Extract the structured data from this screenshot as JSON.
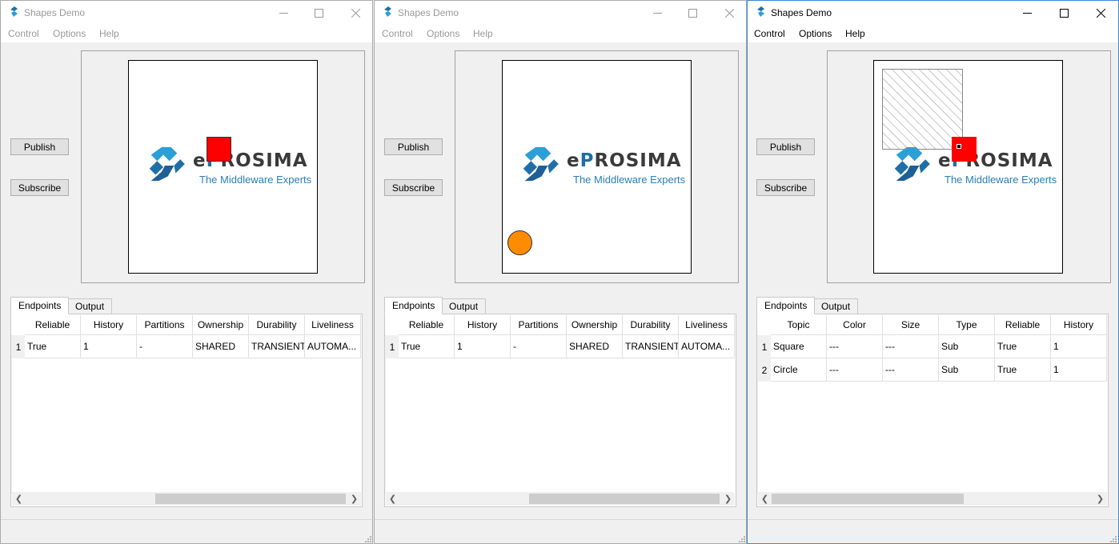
{
  "windows": [
    {
      "title": "Shapes Demo",
      "menu": [
        "Control",
        "Options",
        "Help"
      ],
      "buttons": {
        "publish": "Publish",
        "subscribe": "Subscribe"
      },
      "logo": {
        "word_prefix": "e",
        "word_accent": "P",
        "word_rest": "ROSIMA",
        "tagline": "The Middleware Experts"
      },
      "tabs": [
        "Endpoints",
        "Output"
      ],
      "table": {
        "headers": [
          "Reliable",
          "History",
          "Partitions",
          "Ownership",
          "Durability",
          "Liveliness"
        ],
        "rows": [
          {
            "num": "1",
            "cells": [
              "True",
              "1",
              "-",
              "SHARED",
              "TRANSIENT",
              "AUTOMA..."
            ]
          }
        ]
      },
      "shapes": [
        {
          "kind": "square",
          "color": "#ff0000"
        }
      ]
    },
    {
      "title": "Shapes Demo",
      "menu": [
        "Control",
        "Options",
        "Help"
      ],
      "buttons": {
        "publish": "Publish",
        "subscribe": "Subscribe"
      },
      "logo": {
        "word_prefix": "e",
        "word_accent": "P",
        "word_rest": "ROSIMA",
        "tagline": "The Middleware Experts"
      },
      "tabs": [
        "Endpoints",
        "Output"
      ],
      "table": {
        "headers": [
          "Reliable",
          "History",
          "Partitions",
          "Ownership",
          "Durability",
          "Liveliness"
        ],
        "rows": [
          {
            "num": "1",
            "cells": [
              "True",
              "1",
              "-",
              "SHARED",
              "TRANSIENT",
              "AUTOMA..."
            ]
          }
        ]
      },
      "shapes": [
        {
          "kind": "circle",
          "color": "#ff8c00"
        }
      ]
    },
    {
      "title": "Shapes Demo",
      "menu": [
        "Control",
        "Options",
        "Help"
      ],
      "buttons": {
        "publish": "Publish",
        "subscribe": "Subscribe"
      },
      "logo": {
        "word_prefix": "e",
        "word_accent": "P",
        "word_rest": "ROSIMA",
        "tagline": "The Middleware Experts"
      },
      "tabs": [
        "Endpoints",
        "Output"
      ],
      "table": {
        "headers": [
          "Topic",
          "Color",
          "Size",
          "Type",
          "Reliable",
          "History"
        ],
        "rows": [
          {
            "num": "1",
            "cells": [
              "Square",
              "---",
              "---",
              "Sub",
              "True",
              "1"
            ]
          },
          {
            "num": "2",
            "cells": [
              "Circle",
              "---",
              "---",
              "Sub",
              "True",
              "1"
            ]
          }
        ]
      },
      "shapes": [
        {
          "kind": "content-filter-area",
          "color": "#888888"
        },
        {
          "kind": "square",
          "color": "#ff0000"
        }
      ]
    }
  ],
  "colors": {
    "brand_blue": "#1f6fa6",
    "active_border": "#3c88d8"
  },
  "icons": {
    "app": "shapes-app-icon",
    "minimize": "minimize-icon",
    "maximize": "maximize-icon",
    "close": "close-icon",
    "scroll_left": "scroll-left-arrow-icon",
    "scroll_right": "scroll-right-arrow-icon",
    "resize_grip": "resize-grip-icon"
  }
}
